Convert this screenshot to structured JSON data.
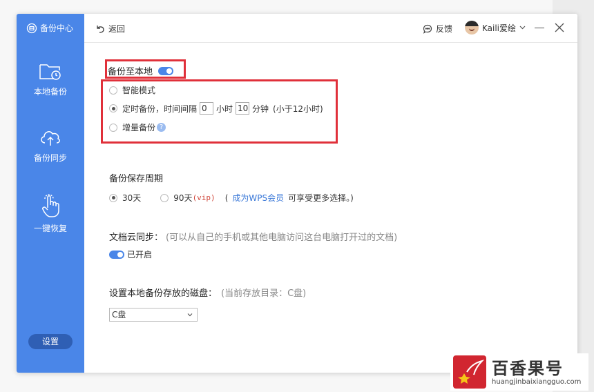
{
  "sidebar": {
    "brand": "备份中心",
    "items": [
      {
        "label": "本地备份",
        "icon": "folder-clock-icon"
      },
      {
        "label": "备份同步",
        "icon": "cloud-upload-icon"
      },
      {
        "label": "一键恢复",
        "icon": "hand-pointer-icon"
      }
    ],
    "settings": "设置"
  },
  "topbar": {
    "back": "返回",
    "feedback": "反馈",
    "user": "Kaili爱绘"
  },
  "local_backup": {
    "title": "备份至本地",
    "enabled": true,
    "modes": {
      "smart": "智能模式",
      "timed_prefix": "定时备份，时间间隔",
      "hours_value": "0",
      "hours_unit": "小时",
      "minutes_value": "10",
      "minutes_unit": "分钟",
      "timed_note": "(小于12小时)",
      "incremental": "增量备份",
      "help": "?",
      "selected": "timed"
    }
  },
  "retention": {
    "title": "备份保存周期",
    "option_30": "30天",
    "option_90": "90天",
    "vip_tag": "(vip)",
    "note_open": "(",
    "note_link": "成为WPS会员",
    "note_rest": "可享受更多选择。)",
    "selected": "30"
  },
  "cloud_sync": {
    "title": "文档云同步：",
    "note": "(可以从自己的手机或其他电脑访问这台电脑打开过的文档)",
    "status": "已开启"
  },
  "disk": {
    "title": "设置本地备份存放的磁盘：",
    "note": "(当前存放目录：C盘)",
    "selected": "C盘"
  },
  "watermark": {
    "name": "百香果号",
    "url": "huangjinbaixiangguo.com"
  },
  "colors": {
    "sidebar": "#4a86e8",
    "accent": "#4a86e8",
    "highlight": "#e0303a",
    "link": "#3a78d8"
  }
}
